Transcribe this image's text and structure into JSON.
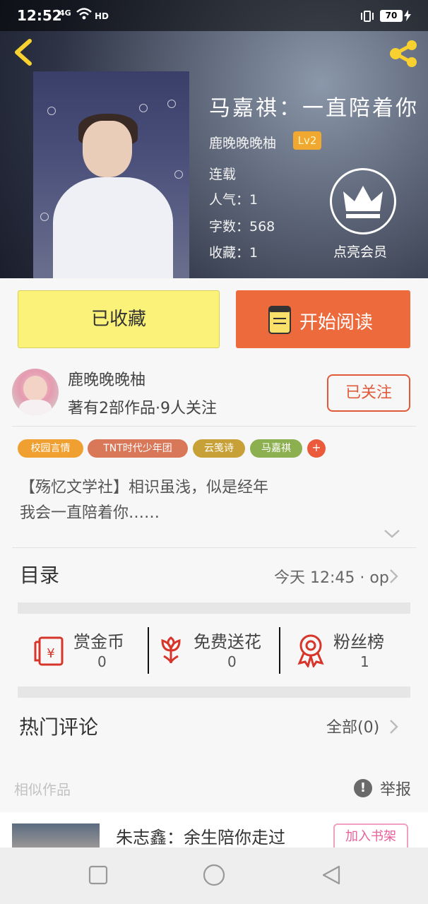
{
  "status_bar": {
    "time": "12:52",
    "network": "4G",
    "hd": "HD",
    "battery": "70"
  },
  "book": {
    "title": "马嘉祺：一直陪着你",
    "author": "鹿晚晚晚柚",
    "level": "Lv2",
    "status": "连载",
    "popularity": "人气：1",
    "word_count": "字数：568",
    "favorites": "收藏：1",
    "vip_label": "点亮会员"
  },
  "actions": {
    "collected_label": "已收藏",
    "read_label": "开始阅读"
  },
  "author_row": {
    "name": "鹿晚晚晚柚",
    "stats": "著有2部作品·9人关注",
    "follow_label": "已关注"
  },
  "tags": [
    {
      "label": "校园言情",
      "color": "#f0a030"
    },
    {
      "label": "TNT时代少年团",
      "color": "#d87858"
    },
    {
      "label": "云笺诗",
      "color": "#c8a038"
    },
    {
      "label": "马嘉祺",
      "color": "#8cb050"
    }
  ],
  "tag_add": "+",
  "intro": {
    "line1": "【殇忆文学社】相识虽浅，似是经年",
    "line2": "我会一直陪着你……"
  },
  "catalog": {
    "label": "目录",
    "update": "今天 12:45 · op"
  },
  "rewards": [
    {
      "label": "赏金币",
      "count": "0",
      "icon": "red-envelope-icon"
    },
    {
      "label": "免费送花",
      "count": "0",
      "icon": "flower-icon"
    },
    {
      "label": "粉丝榜",
      "count": "1",
      "icon": "medal-icon"
    }
  ],
  "comments": {
    "label": "热门评论",
    "all_label": "全部(0)"
  },
  "similar": {
    "label": "相似作品",
    "report_label": "举报",
    "report_icon": "!",
    "item_title": "朱志鑫：余生陪你走过",
    "shelf_label": "加入书架"
  },
  "colors": {
    "accent_orange": "#ec6a3c",
    "collected_yellow": "#fbf27a",
    "share_yellow": "#f8d030",
    "follow_red": "#e05a3a",
    "icon_red": "#d8352a"
  }
}
